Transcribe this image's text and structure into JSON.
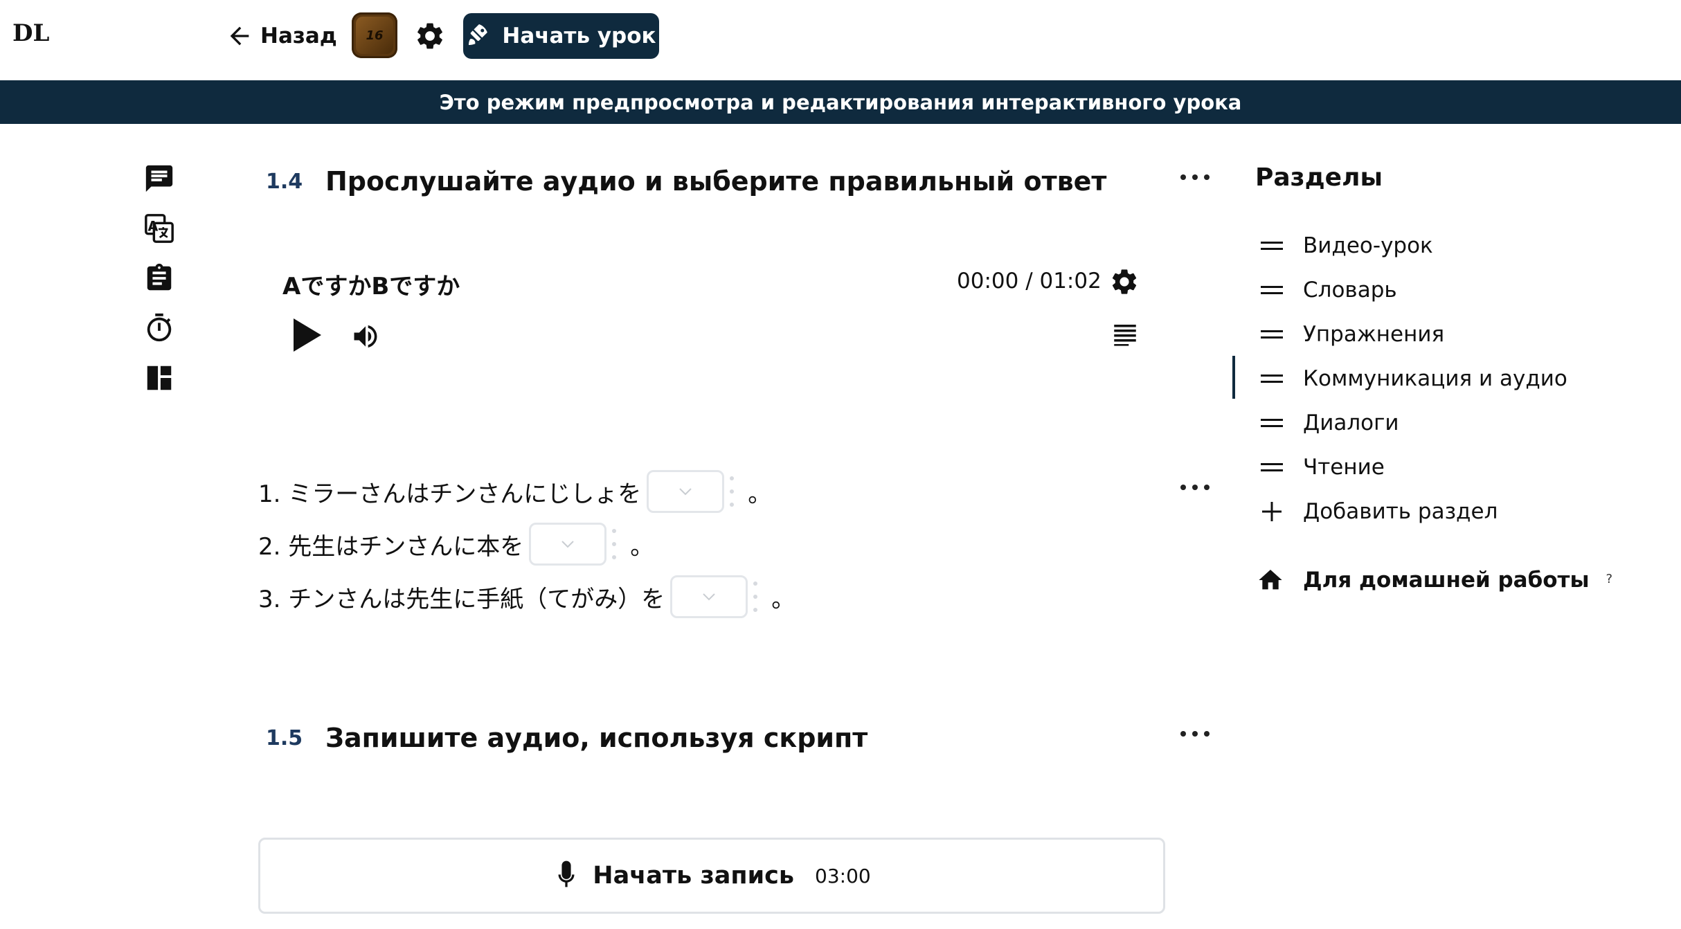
{
  "app": {
    "logo": "DL"
  },
  "header": {
    "back_label": "Назад",
    "avatar_text": "16",
    "start_label": "Начать урок"
  },
  "banner": {
    "text": "Это режим предпросмотра и редактирования интерактивного урока"
  },
  "sections": [
    {
      "number": "1.4",
      "title": "Прослушайте аудио и выберите правильный ответ"
    },
    {
      "number": "1.5",
      "title": "Запишите аудио, используя скрипт"
    }
  ],
  "audio": {
    "title": "AですかBですか",
    "time": "00:00 / 01:02"
  },
  "questions": [
    {
      "text": "1. ミラーさんはチンさんにじしょを",
      "end": "。",
      "selected": ""
    },
    {
      "text": "2. 先生はチンさんに本を",
      "end": "。",
      "selected": ""
    },
    {
      "text": "3. チンさんは先生に手紙（てがみ）を",
      "end": "。",
      "selected": ""
    }
  ],
  "recorder": {
    "label": "Начать запись",
    "time": "03:00"
  },
  "sidebar": {
    "title": "Разделы",
    "items": [
      {
        "label": "Видео-урок"
      },
      {
        "label": "Словарь"
      },
      {
        "label": "Упражнения"
      },
      {
        "label": "Коммуникация и аудио",
        "active": true
      },
      {
        "label": "Диалоги"
      },
      {
        "label": "Чтение"
      }
    ],
    "add_label": "Добавить раздел",
    "homework_label": "Для домашней работы",
    "homework_help": "?"
  },
  "colors": {
    "primary_dark": "#0f2a3e",
    "section_number": "#1e3a5f",
    "select_border": "#e3e6ea"
  },
  "icons": {
    "tools": [
      "chat-icon",
      "translate-icon",
      "clipboard-icon",
      "timer-icon",
      "layout-icon"
    ]
  }
}
